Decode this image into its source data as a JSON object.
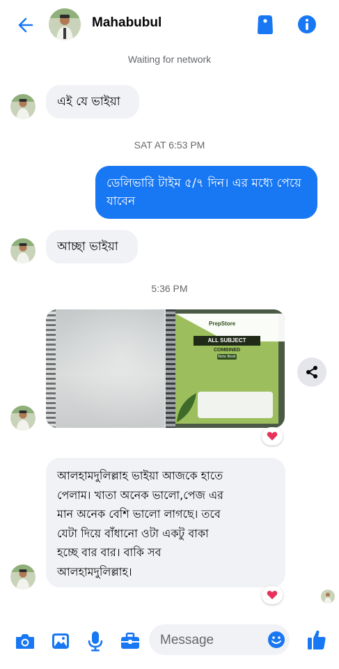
{
  "header": {
    "contact_name": "Mahabubul",
    "network_status": "Waiting for network"
  },
  "messages": [
    {
      "from": "contact",
      "text": "এই যে ভাইয়া"
    },
    {
      "timestamp": "SAT AT 6:53 PM"
    },
    {
      "from": "me",
      "text": "ডেলিভারি টাইম ৫/৭ দিন। এর মধ্যে পেয়ে যাবেন"
    },
    {
      "from": "contact",
      "text": "আচ্ছা ভাইয়া"
    },
    {
      "timestamp": "5:36 PM"
    },
    {
      "from": "contact",
      "type": "photos",
      "notebook_cover": {
        "brand": "PrepStore",
        "title": "ALL SUBJECT",
        "subtitle": "COMBINED",
        "tag": "Note Book"
      },
      "reaction": "heart"
    },
    {
      "from": "contact",
      "lines": [
        "আলহামদুলিল্লাহ ভাইয়া আজকে হাতে",
        "পেলাম। খাতা অনেক ভালো,পেজ এর",
        "মান অনেক বেশি ভালো লাগছে। তবে",
        "যেটা দিয়ে বাঁধানো ওটা একটু বাকা",
        "হচ্ছে বার বার। বাকি সব",
        "আলহামদুলিল্লাহ।"
      ],
      "reaction": "heart"
    }
  ],
  "composer": {
    "placeholder": "Message"
  },
  "colors": {
    "accent": "#1877f2",
    "incoming_bubble": "#f0f2f5",
    "heart": "#e8325a"
  }
}
